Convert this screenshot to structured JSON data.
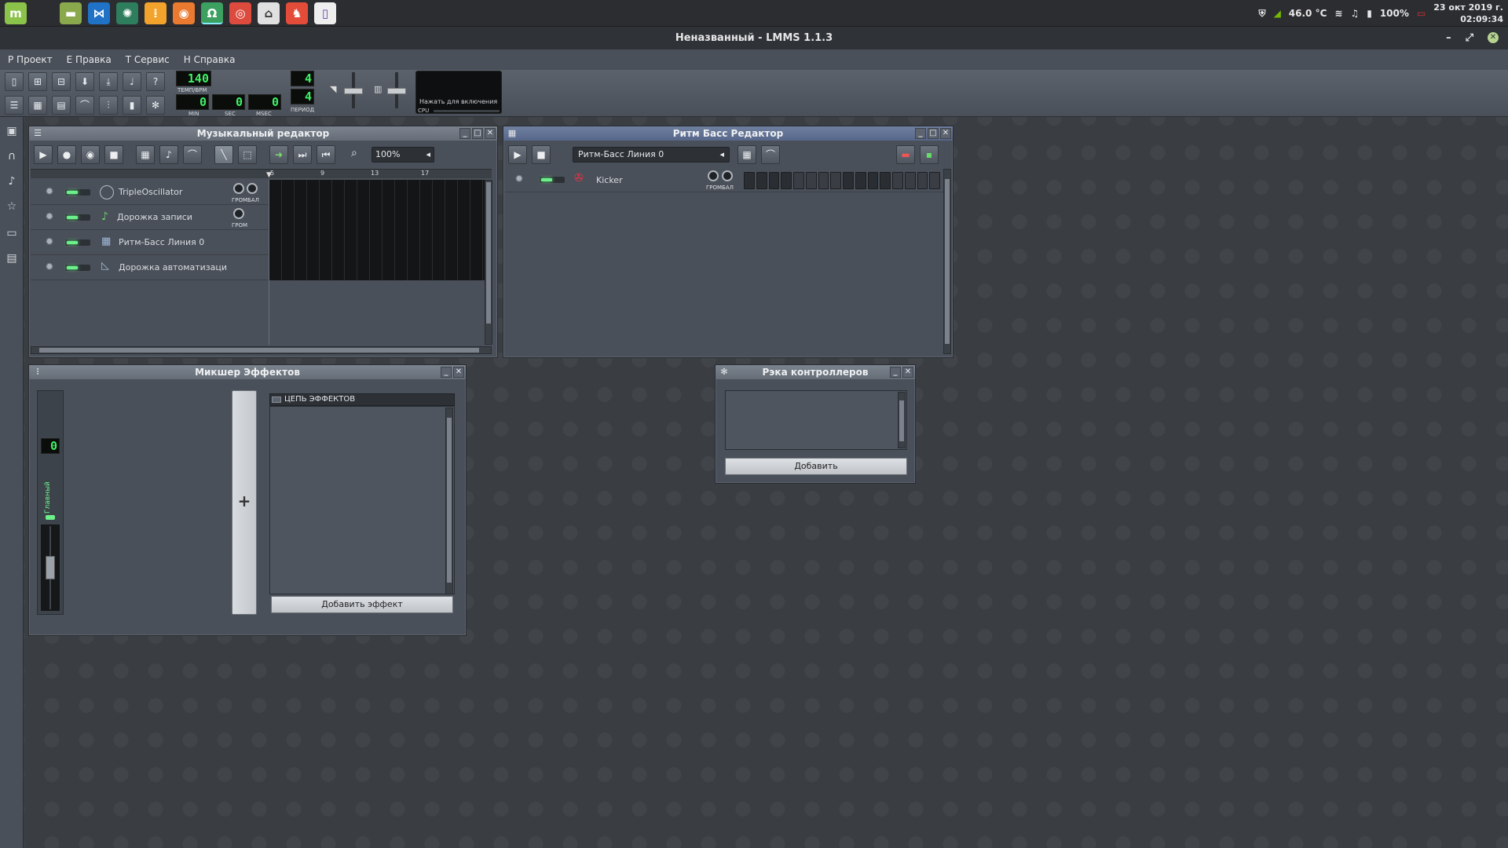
{
  "system": {
    "apps": [
      "mint-icon",
      "files-icon",
      "vscode-icon",
      "atom-icon",
      "mixer-icon",
      "blender-icon",
      "headphones-icon",
      "chrome-icon",
      "app-icon",
      "git-icon",
      "twitch-icon"
    ],
    "temp": "46.0 °C",
    "battery": "100%",
    "date": "23 окт 2019 г.",
    "time": "02:09:34"
  },
  "window": {
    "title": "Неназванный - LMMS 1.1.3"
  },
  "menu": {
    "items": [
      "Р Проект",
      "Е Правка",
      "Т Сервис",
      "Н Справка"
    ]
  },
  "toolbar": {
    "tempo": "140",
    "tempo_label": "ТЕМП/BPM",
    "min": "0",
    "sec": "0",
    "msec": "0",
    "min_label": "MIN",
    "sec_label": "SEC",
    "msec_label": "MSEC",
    "sig_top": "4",
    "sig_bottom": "4",
    "sig_label": "ПЕРИОД",
    "cpu_hint": "Нажать для включения",
    "cpu_label": "CPU"
  },
  "song_editor": {
    "title": "Музыкальный редактор",
    "zoom": "100%",
    "ruler": [
      "5",
      "9",
      "13",
      "17"
    ],
    "tracks": [
      {
        "name": "TripleOscillator",
        "knob_label": "ГРОМБАЛ"
      },
      {
        "name": "Дорожка записи",
        "knob_label": "ГРОМ"
      },
      {
        "name": "Ритм-Басс Линия 0",
        "knob_label": ""
      },
      {
        "name": "Дорожка автоматизаци",
        "knob_label": ""
      }
    ]
  },
  "bb_editor": {
    "title": "Ритм Басс Редактор",
    "track_select": "Ритм-Басс Линия 0",
    "tracks": [
      {
        "name": "Kicker",
        "knob_label": "ГРОМБАЛ"
      }
    ],
    "steps": 16
  },
  "fx_mixer": {
    "title": "Микшер Эффектов",
    "channel_num": "0",
    "channel_name": "Главный",
    "chain_label": "ЦЕПЬ ЭФФЕКТОВ",
    "add_effect": "Добавить эффект"
  },
  "controller_rack": {
    "title": "Рэка контроллеров",
    "add": "Добавить"
  }
}
